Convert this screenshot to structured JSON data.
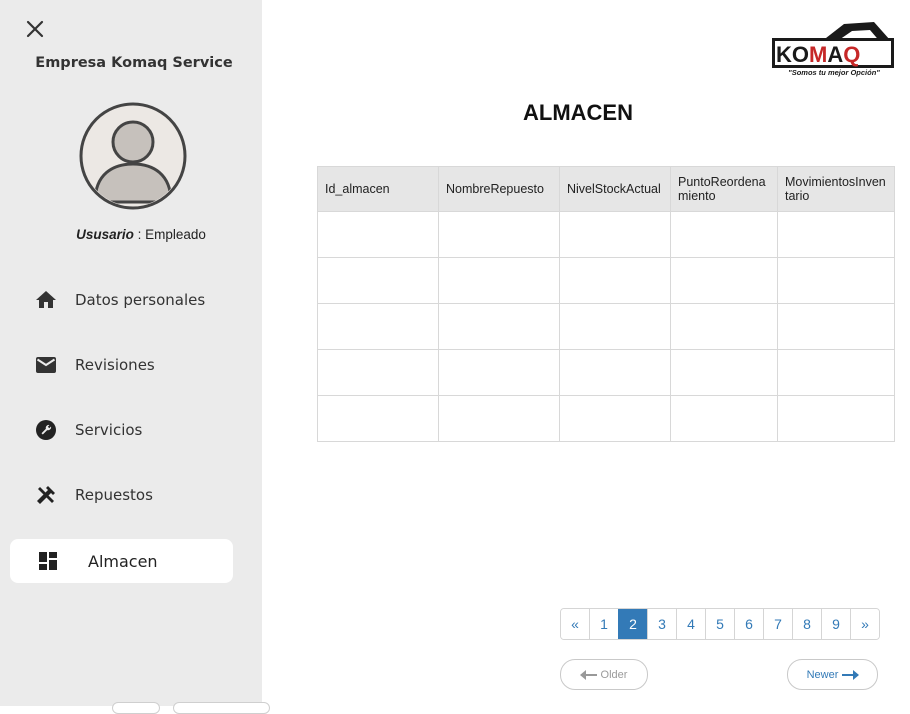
{
  "sidebar": {
    "company_name": "Empresa Komaq Service",
    "user_label": "Ususario",
    "user_separator": " : ",
    "user_role": "Empleado",
    "items": [
      {
        "label": "Datos personales",
        "icon": "home-icon"
      },
      {
        "label": "Revisiones",
        "icon": "mail-icon"
      },
      {
        "label": "Servicios",
        "icon": "wrench-icon"
      },
      {
        "label": "Repuestos",
        "icon": "tools-icon"
      },
      {
        "label": "Almacen",
        "icon": "dashboard-icon",
        "active": true
      }
    ]
  },
  "logo": {
    "brand": "KOMAQ",
    "tagline": "\"Somos tu mejor Opción\""
  },
  "page": {
    "title": "ALMACEN"
  },
  "table": {
    "columns": [
      "Id_almacen",
      "NombreRepuesto",
      "NivelStockActual",
      "PuntoReordenamiento",
      "MovimientosInventario"
    ],
    "rows": [
      [
        "",
        "",
        "",
        "",
        ""
      ],
      [
        "",
        "",
        "",
        "",
        ""
      ],
      [
        "",
        "",
        "",
        "",
        ""
      ],
      [
        "",
        "",
        "",
        "",
        ""
      ],
      [
        "",
        "",
        "",
        "",
        ""
      ]
    ]
  },
  "pagination": {
    "prev": "«",
    "pages": [
      "1",
      "2",
      "3",
      "4",
      "5",
      "6",
      "7",
      "8",
      "9"
    ],
    "current": "2",
    "next": "»"
  },
  "pager": {
    "older": "Older",
    "newer": "Newer"
  },
  "colors": {
    "sidebar_bg": "#ebebeb",
    "accent": "#337ab7",
    "brand_red": "#c62828"
  }
}
